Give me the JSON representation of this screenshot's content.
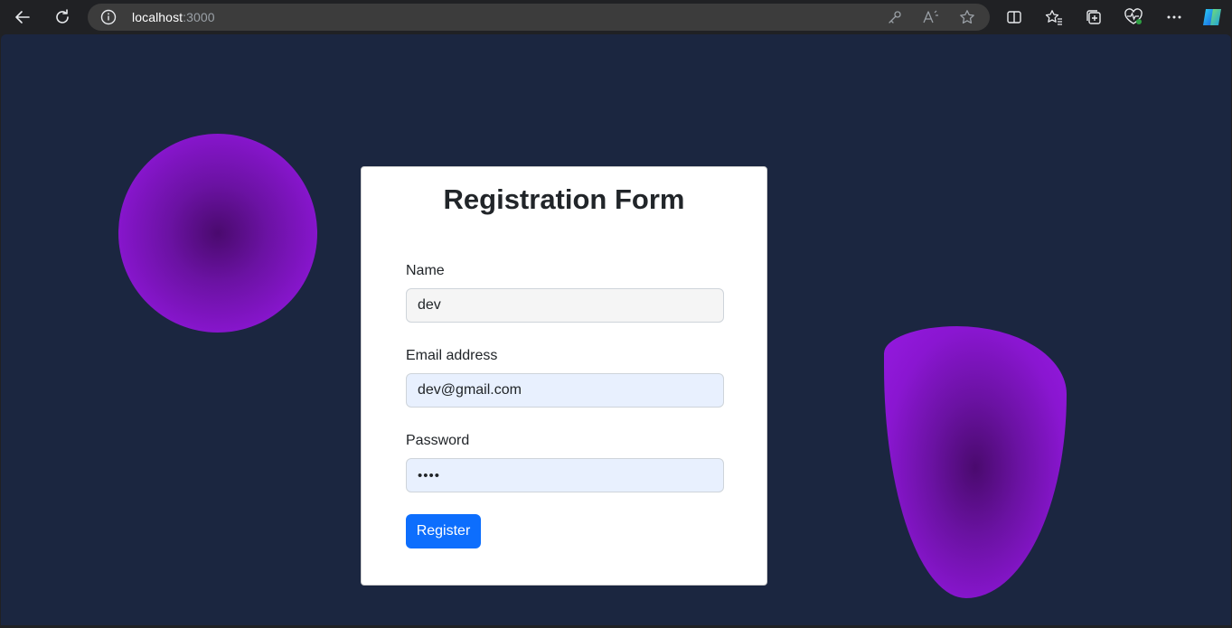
{
  "browser": {
    "url_host": "localhost",
    "url_port": ":3000",
    "icons": [
      "back-icon",
      "refresh-icon",
      "info-icon",
      "key-icon",
      "read-aloud-icon",
      "favorite-star-icon",
      "split-screen-icon",
      "favorites-icon",
      "collections-icon",
      "health-icon",
      "more-icon",
      "copilot-icon"
    ]
  },
  "form": {
    "title": "Registration Form",
    "name_label": "Name",
    "name_value": "dev",
    "email_label": "Email address",
    "email_value": "dev@gmail.com",
    "password_label": "Password",
    "password_value": "••••",
    "submit_label": "Register"
  },
  "colors": {
    "page_bg": "#1b2640",
    "accent": "#0d6efd",
    "blob": "#8a16d1"
  }
}
